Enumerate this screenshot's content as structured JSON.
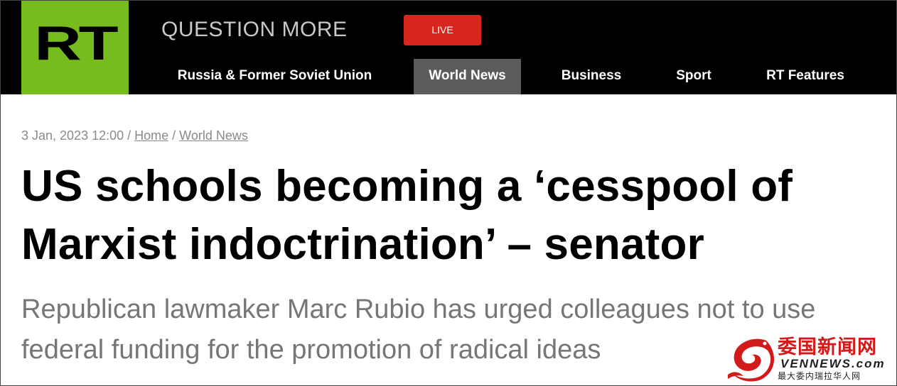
{
  "header": {
    "logo": "RT",
    "slogan": "QUESTION MORE",
    "live_label": "LIVE",
    "nav": [
      {
        "label": "Russia & Former Soviet Union",
        "active": false
      },
      {
        "label": "World News",
        "active": true
      },
      {
        "label": "Business",
        "active": false
      },
      {
        "label": "Sport",
        "active": false
      },
      {
        "label": "RT Features",
        "active": false
      }
    ]
  },
  "article": {
    "date": "3 Jan, 2023 12:00",
    "breadcrumb": [
      "Home",
      "World News"
    ],
    "headline_line1": "US schools becoming a ‘cesspool of",
    "headline_line2": "Marxist indoctrination’ – senator",
    "summary_line1": "Republican lawmaker Marc Rubio has urged colleagues not to use",
    "summary_line2": "federal funding for the promotion of radical ideas"
  },
  "watermark": {
    "icon": "dragon-logo-icon",
    "name_cn": "委国新闻网",
    "name_en": "VENNEWS.com",
    "tagline": "最大委内瑞拉华人网"
  },
  "colors": {
    "brand_green": "#77bc1f",
    "live_red": "#d7261e",
    "header_bg": "#000000",
    "nav_active_bg": "#5b5b5b",
    "watermark_red": "#d21a1a"
  }
}
